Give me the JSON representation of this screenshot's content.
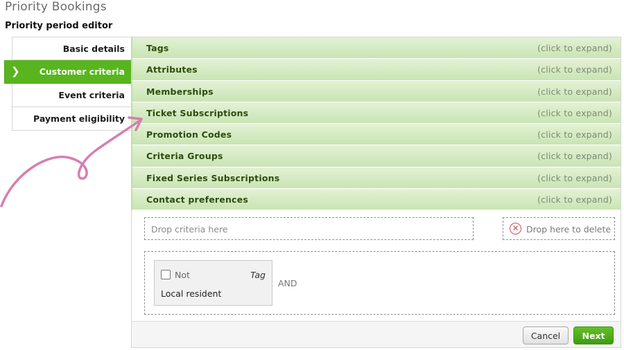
{
  "app": {
    "title": "Priority Bookings"
  },
  "editor": {
    "title": "Priority period editor"
  },
  "steps": [
    {
      "label": "Basic details",
      "active": false
    },
    {
      "label": "Customer criteria",
      "active": true
    },
    {
      "label": "Event criteria",
      "active": false
    },
    {
      "label": "Payment eligibility",
      "active": false
    }
  ],
  "accordion": {
    "hint": "(click to expand)",
    "items": [
      {
        "label": "Tags"
      },
      {
        "label": "Attributes"
      },
      {
        "label": "Memberships"
      },
      {
        "label": "Ticket Subscriptions"
      },
      {
        "label": "Promotion Codes"
      },
      {
        "label": "Criteria Groups"
      },
      {
        "label": "Fixed Series Subscriptions"
      },
      {
        "label": "Contact preferences"
      }
    ]
  },
  "dropzone": {
    "label": "Drop criteria here"
  },
  "deletezone": {
    "label": "Drop here to delete",
    "icon": "close-circle-icon"
  },
  "criteria": {
    "card": {
      "not_label": "Not",
      "type": "Tag",
      "value": "Local resident",
      "not_checked": false
    },
    "joiner": "AND"
  },
  "footer": {
    "cancel_label": "Cancel",
    "next_label": "Next"
  },
  "colors": {
    "accent": "#58b51e",
    "accordion_bg": "#d3e9bf",
    "annotation": "#d67fae",
    "delete": "#d24a55"
  }
}
